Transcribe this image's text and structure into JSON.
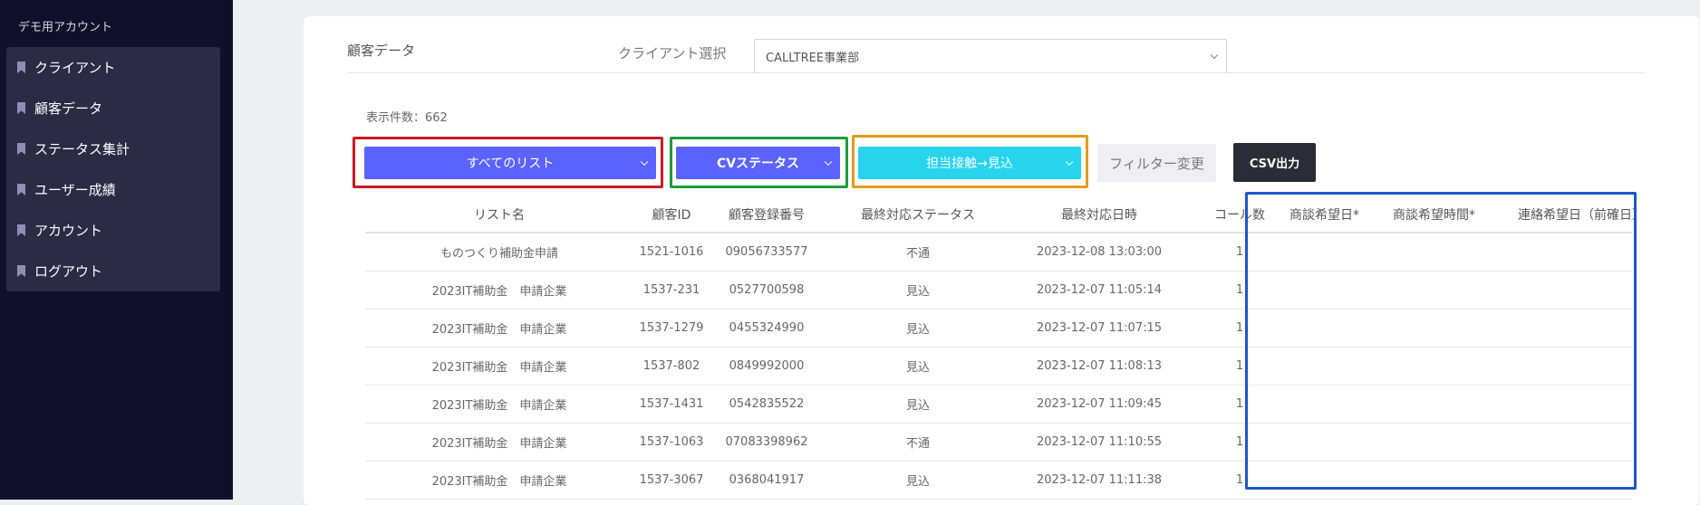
{
  "sidebar": {
    "title": "デモ用アカウント",
    "items": [
      {
        "label": "クライアント"
      },
      {
        "label": "顧客データ"
      },
      {
        "label": "ステータス集計"
      },
      {
        "label": "ユーザー成績"
      },
      {
        "label": "アカウント"
      },
      {
        "label": "ログアウト"
      }
    ]
  },
  "main": {
    "title": "顧客データ",
    "client_label": "クライアント選択",
    "client_value": "CALLTREE事業部",
    "count_text": "表示件数：662",
    "filters": {
      "list_select": "すべてのリスト",
      "cv_select": "CVステータス",
      "status_select": "担当接触→見込",
      "filter_button": "フィルター変更",
      "csv_button": "CSV出力"
    },
    "colors": {
      "primary": "#5a63fb",
      "cyan": "#28d3ee",
      "sidebar_bg": "#110f2c",
      "highlight_red": "#c71d24",
      "highlight_green": "#1e9c3a",
      "highlight_orange": "#e39b20",
      "highlight_blue": "#1c57c8"
    }
  },
  "table": {
    "headers": [
      "リスト名",
      "顧客ID",
      "顧客登録番号",
      "最終対応ステータス",
      "最終対応日時",
      "コール数",
      "商談希望日*",
      "商談希望時間*",
      "連絡希望日（前確日）"
    ],
    "rows": [
      [
        "ものつくり補助金申請",
        "1521-1016",
        "09056733577",
        "不通",
        "2023-12-08 13:03:00",
        "1",
        "",
        "",
        ""
      ],
      [
        "2023IT補助金　申請企業",
        "1537-231",
        "0527700598",
        "見込",
        "2023-12-07 11:05:14",
        "1",
        "",
        "",
        ""
      ],
      [
        "2023IT補助金　申請企業",
        "1537-1279",
        "0455324990",
        "見込",
        "2023-12-07 11:07:15",
        "1",
        "",
        "",
        ""
      ],
      [
        "2023IT補助金　申請企業",
        "1537-802",
        "0849992000",
        "見込",
        "2023-12-07 11:08:13",
        "1",
        "",
        "",
        ""
      ],
      [
        "2023IT補助金　申請企業",
        "1537-1431",
        "0542835522",
        "見込",
        "2023-12-07 11:09:45",
        "1",
        "",
        "",
        ""
      ],
      [
        "2023IT補助金　申請企業",
        "1537-1063",
        "07083398962",
        "不通",
        "2023-12-07 11:10:55",
        "1",
        "",
        "",
        ""
      ],
      [
        "2023IT補助金　申請企業",
        "1537-3067",
        "0368041917",
        "見込",
        "2023-12-07 11:11:38",
        "1",
        "",
        "",
        ""
      ]
    ]
  }
}
